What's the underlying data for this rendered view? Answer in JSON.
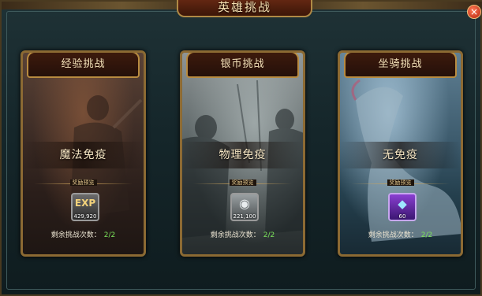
{
  "window": {
    "title": "英雄挑战"
  },
  "cards": [
    {
      "title": "经验挑战",
      "immunity": "魔法免疫",
      "reward_label": "奖励预览",
      "reward_icon": "exp-icon",
      "reward_glyph": "EXP",
      "reward_count": "429,920",
      "remaining_label": "剩余挑战次数：",
      "remaining_value": "2/2"
    },
    {
      "title": "银币挑战",
      "immunity": "物理免疫",
      "reward_label": "奖励预览",
      "reward_icon": "silver-coin-icon",
      "reward_glyph": "◉",
      "reward_count": "221,100",
      "remaining_label": "剩余挑战次数：",
      "remaining_value": "2/2"
    },
    {
      "title": "坐骑挑战",
      "immunity": "无免疫",
      "reward_label": "奖励预览",
      "reward_icon": "mount-crystal-icon",
      "reward_glyph": "◆",
      "reward_count": "60",
      "remaining_label": "剩余挑战次数：",
      "remaining_value": "2/2"
    }
  ],
  "close_glyph": "×"
}
